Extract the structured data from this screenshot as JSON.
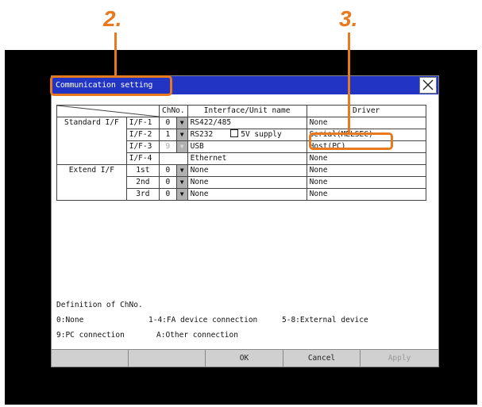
{
  "callouts": {
    "two": "2.",
    "three": "3."
  },
  "dialog": {
    "title": "Communication setting",
    "headers": {
      "chno": "ChNo.",
      "interface": "Interface/Unit name",
      "driver": "Driver"
    },
    "rows": [
      {
        "group": "Standard I/F",
        "port": "I/F-1",
        "ch": "0",
        "iface": "RS422/485",
        "driver": "None"
      },
      {
        "port": "I/F-2",
        "ch": "1",
        "iface": "RS232",
        "supply": "5V supply",
        "driver": "Serial(MELSEC)"
      },
      {
        "port": "I/F-3",
        "ch": "9",
        "iface": "USB",
        "driver": "Host(PC)"
      },
      {
        "port": "I/F-4",
        "ch": "",
        "iface": "Ethernet",
        "driver": "None"
      },
      {
        "group": "Extend I/F",
        "port": "1st",
        "ch": "0",
        "iface": "None",
        "driver": "None"
      },
      {
        "port": "2nd",
        "ch": "0",
        "iface": "None",
        "driver": "None"
      },
      {
        "port": "3rd",
        "ch": "0",
        "iface": "None",
        "driver": "None"
      }
    ],
    "definition": {
      "title": "Definition of ChNo.",
      "line1a": "0:None",
      "line1b": "1-4:FA device connection",
      "line1c": "5-8:External device",
      "line2a": "9:PC connection",
      "line2b": "A:Other connection"
    },
    "buttons": {
      "ok": "OK",
      "cancel": "Cancel",
      "apply": "Apply"
    }
  },
  "colors": {
    "accent": "#e8791e",
    "titlebar": "#2234c4"
  }
}
